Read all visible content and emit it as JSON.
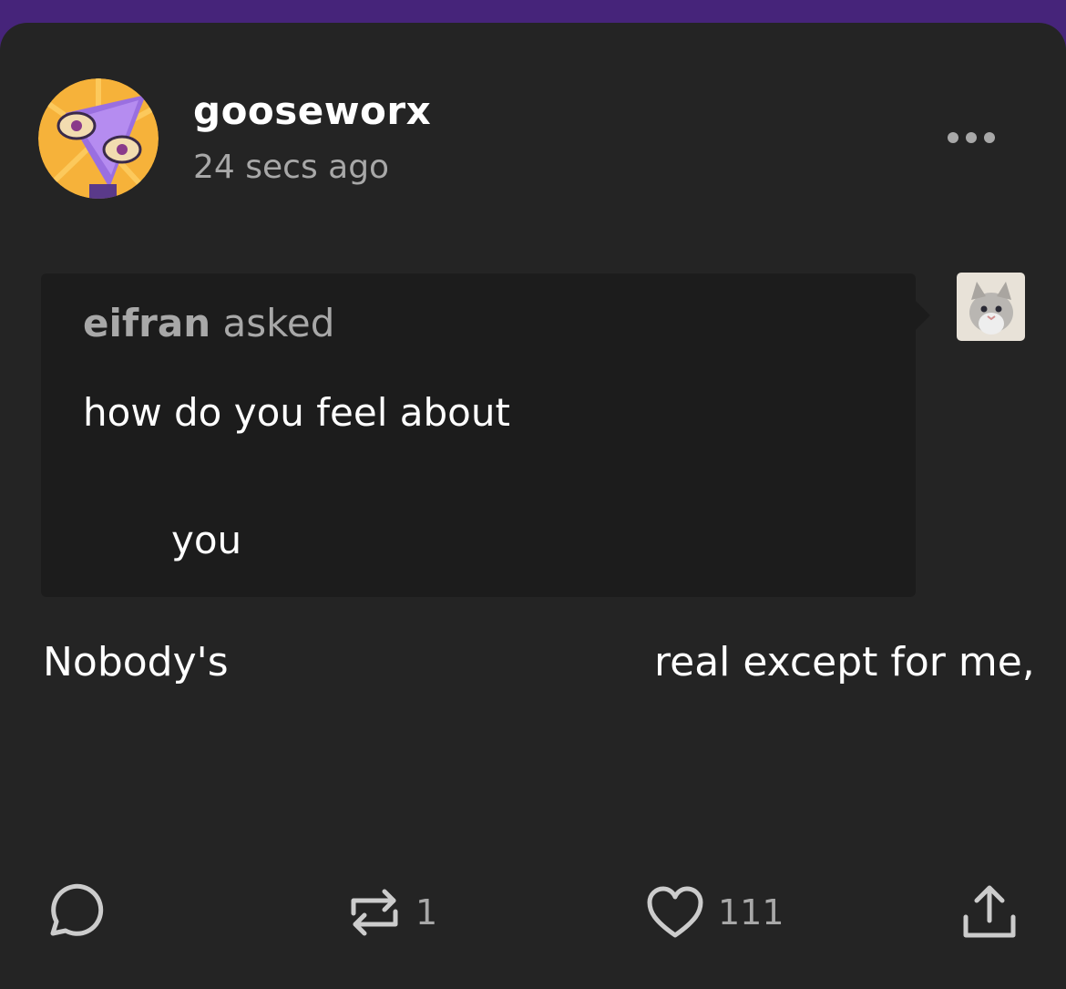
{
  "post": {
    "username": "gooseworx",
    "timestamp": "24 secs ago"
  },
  "ask": {
    "asker": "eifran",
    "asked_label": "asked",
    "question_line1": "how do you feel about",
    "question_line2": "you"
  },
  "answer": {
    "part1": "Nobody's",
    "part2": "real except for me,"
  },
  "actions": {
    "reblog_count": "1",
    "like_count": "111"
  },
  "colors": {
    "page_bg": "#46247a",
    "card_bg": "#242424",
    "ask_bg": "#1c1c1c",
    "muted_text": "#a8a8a8",
    "icon": "#cccccc"
  },
  "icons": [
    "more-options-icon",
    "comment-icon",
    "reblog-icon",
    "heart-icon",
    "share-icon"
  ]
}
